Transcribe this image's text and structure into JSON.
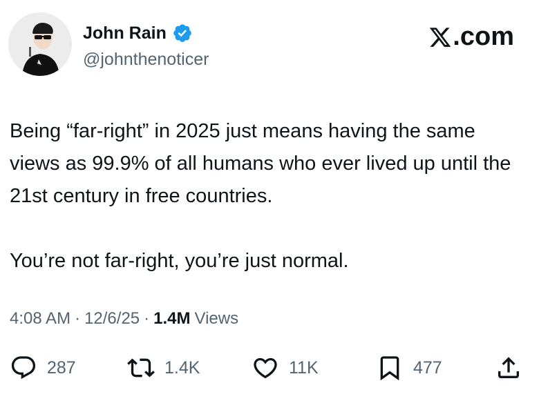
{
  "header": {
    "display_name": "John Rain",
    "handle": "@johnthenoticer",
    "brand": ".com",
    "verified_color": "#1d9bf0"
  },
  "tweet": {
    "paragraphs": [
      "Being “far-right” in 2025 just means having the same views as 99.9% of all humans who ever lived up until the 21st century in free countries.",
      "You’re not far-right, you’re just normal."
    ]
  },
  "meta": {
    "time": "4:08 AM",
    "separator": "·",
    "date": "12/6/25",
    "views_count": "1.4M",
    "views_label": "Views"
  },
  "actions": {
    "replies": "287",
    "reposts": "1.4K",
    "likes": "11K",
    "bookmarks": "477"
  },
  "icons": {
    "reply": "reply-icon",
    "repost": "repost-icon",
    "like": "heart-icon",
    "bookmark": "bookmark-icon",
    "share": "share-icon",
    "brand": "x-logo-icon",
    "verified": "verified-badge-icon"
  }
}
